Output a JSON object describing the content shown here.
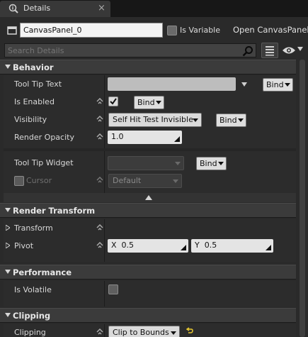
{
  "tab": {
    "title": "Details",
    "close": "×"
  },
  "header": {
    "widget_name": "CanvasPanel_0",
    "is_variable_label": "Is Variable",
    "open_link": "Open CanvasPanel",
    "search_placeholder": "Search Details"
  },
  "sections": {
    "behavior": {
      "title": "Behavior",
      "tooltip_text_label": "Tool Tip Text",
      "tooltip_text_value": "",
      "is_enabled_label": "Is Enabled",
      "is_enabled_checked": true,
      "visibility_label": "Visibility",
      "visibility_value": "Self Hit Test Invisible",
      "render_opacity_label": "Render Opacity",
      "render_opacity_value": "1.0",
      "tooltip_widget_label": "Tool Tip Widget",
      "tooltip_widget_value": "",
      "cursor_label": "Cursor",
      "cursor_value": "Default",
      "bind_label": "Bind"
    },
    "render_transform": {
      "title": "Render Transform",
      "transform_label": "Transform",
      "pivot_label": "Pivot",
      "pivot_x_label": "X",
      "pivot_x": "0.5",
      "pivot_y_label": "Y",
      "pivot_y": "0.5"
    },
    "performance": {
      "title": "Performance",
      "is_volatile_label": "Is Volatile",
      "is_volatile_checked": false
    },
    "clipping": {
      "title": "Clipping",
      "clipping_label": "Clipping",
      "clipping_value": "Clip to Bounds"
    }
  },
  "colors": {
    "panel_bg": "#2a2a2a",
    "section_header_bg": "#3b3b3b",
    "field_bg": "#e4e4e4",
    "reset_arrow": "#e6c830"
  }
}
